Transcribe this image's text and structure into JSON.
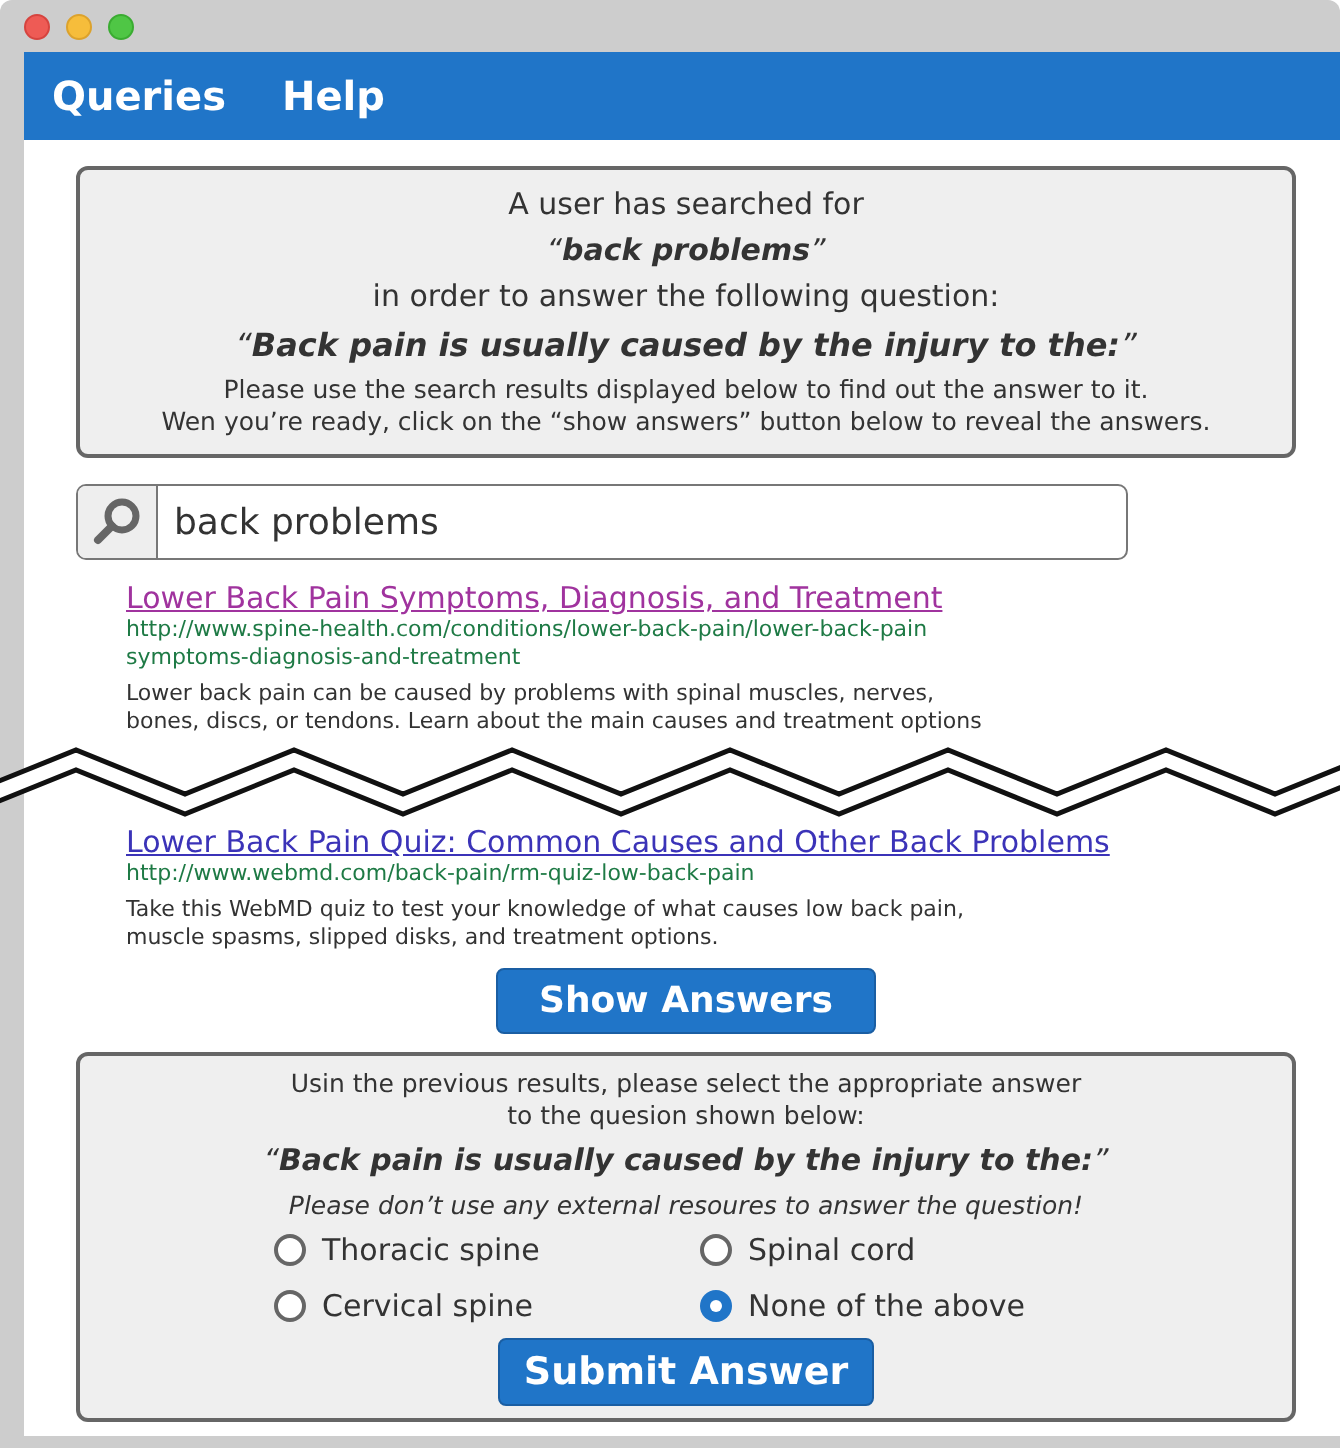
{
  "menu": [
    {
      "label": "Queries"
    },
    {
      "label": "Help"
    }
  ],
  "intro": {
    "lead": "A user has searched for",
    "query": "“**back problems**”",
    "middle": "in order to answer the following question:",
    "question": "“**Back pain is usually caused by the injury to the:**”",
    "instructions": [
      "Please use the search results displayed below to find out the answer to it.",
      "Wen you’re ready, click on the “show answers” button below to reveal the answers."
    ]
  },
  "search": {
    "value": "back problems"
  },
  "results": [
    {
      "title": "Lower Back Pain Symptoms, Diagnosis, and Treatment",
      "visited": true,
      "url_lines": [
        "http://www.spine-health.com/conditions/lower-back-pain/lower-back-pain",
        "symptoms-diagnosis-and-treatment"
      ],
      "snippet_lines": [
        "Lower back pain can be caused by problems with spinal muscles, nerves,",
        "bones, discs, or tendons. Learn about the main causes and treatment options"
      ]
    },
    {
      "title": "Lower Back Pain Quiz: Common Causes and Other Back Problems",
      "visited": false,
      "url_lines": [
        "http://www.webmd.com/back-pain/rm-quiz-low-back-pain"
      ],
      "snippet_lines": [
        "Take this WebMD quiz to test your knowledge of what causes low back pain,",
        "muscle spasms, slipped disks, and treatment options."
      ]
    }
  ],
  "show_answers": "Show Answers",
  "answer_panel": {
    "instructions": [
      "Usin the previous results, please select the appropriate answer",
      "to the quesion shown below:"
    ],
    "question": "“**Back pain is usually caused by the injury to the:**”",
    "warning": "Please don’t use any external resoures to answer the question!",
    "options": [
      {
        "label": "Thoracic spine",
        "selected": false
      },
      {
        "label": "Spinal cord",
        "selected": false
      },
      {
        "label": "Cervical spine",
        "selected": false
      },
      {
        "label": "None of the above",
        "selected": true
      }
    ],
    "submit": "Submit Answer"
  }
}
